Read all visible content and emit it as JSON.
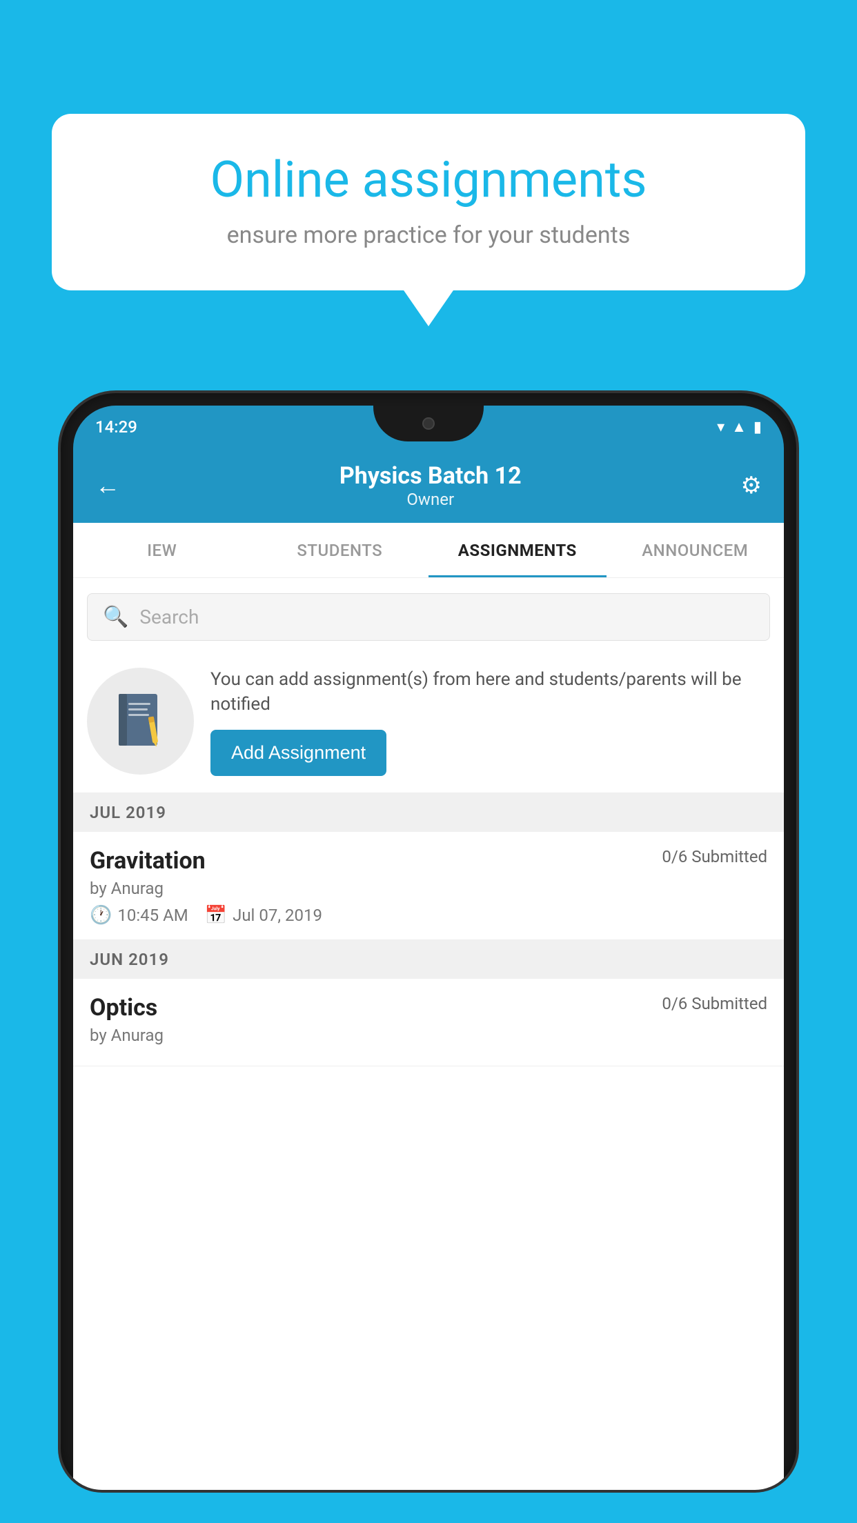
{
  "background_color": "#1ab8e8",
  "speech_bubble": {
    "title": "Online assignments",
    "subtitle": "ensure more practice for your students"
  },
  "phone": {
    "status_bar": {
      "time": "14:29",
      "icons": [
        "wifi",
        "signal",
        "battery"
      ]
    },
    "header": {
      "title": "Physics Batch 12",
      "subtitle": "Owner",
      "back_label": "←",
      "settings_label": "⚙"
    },
    "tabs": [
      {
        "label": "IEW",
        "active": false
      },
      {
        "label": "STUDENTS",
        "active": false
      },
      {
        "label": "ASSIGNMENTS",
        "active": true
      },
      {
        "label": "ANNOUNCEM",
        "active": false
      }
    ],
    "search": {
      "placeholder": "Search"
    },
    "promo": {
      "text": "You can add assignment(s) from here and students/parents will be notified",
      "button_label": "Add Assignment"
    },
    "sections": [
      {
        "month_label": "JUL 2019",
        "assignments": [
          {
            "name": "Gravitation",
            "submitted": "0/6 Submitted",
            "by": "by Anurag",
            "time": "10:45 AM",
            "date": "Jul 07, 2019"
          }
        ]
      },
      {
        "month_label": "JUN 2019",
        "assignments": [
          {
            "name": "Optics",
            "submitted": "0/6 Submitted",
            "by": "by Anurag",
            "time": "",
            "date": ""
          }
        ]
      }
    ]
  }
}
